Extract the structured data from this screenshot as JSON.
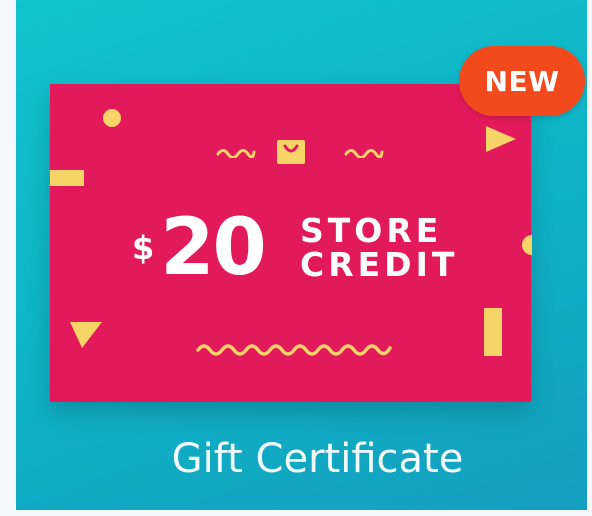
{
  "badge": {
    "label": "NEW"
  },
  "card": {
    "currency_symbol": "$",
    "amount": "20",
    "line1": "STORE",
    "line2": "CREDIT",
    "icon": "shopping-bag-icon"
  },
  "caption": "Gift Certificate",
  "colors": {
    "tile_background": "#0fb6c9",
    "card_background": "#e21a5b",
    "decoration": "#f7d467",
    "badge_background": "#f24a1c",
    "text": "#ffffff"
  }
}
